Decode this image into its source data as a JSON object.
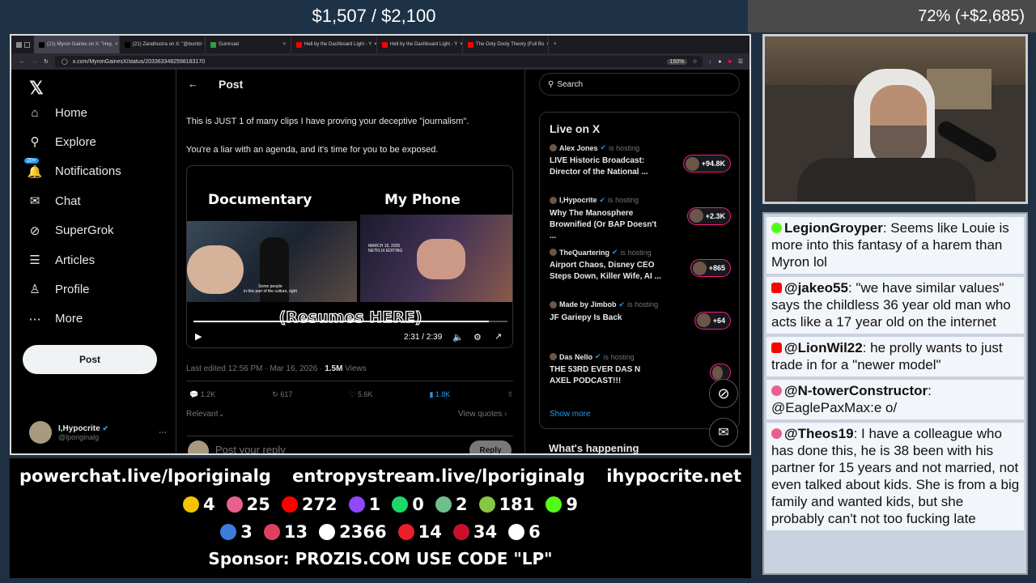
{
  "overlay": {
    "goal": "$1,507 / $2,100",
    "percent": "72% (+$2,685)"
  },
  "browser": {
    "tabs": [
      {
        "label": "(21) Myron Gaines on X: \"Hey,",
        "color": "#000000"
      },
      {
        "label": "(21) Zarathustra on X: \"@bumbl",
        "color": "#000000"
      },
      {
        "label": "Gumroad",
        "color": "#2f9e44"
      },
      {
        "label": "Hell by the Dashboard Light - Y",
        "color": "#ff0000"
      },
      {
        "label": "Hell by the Dashboard Light - Y",
        "color": "#ff0000"
      },
      {
        "label": "The Ooty Dooly Theory (Full Bo",
        "color": "#ff0000"
      }
    ],
    "url": "x.com/MyronGainesX/status/2033633482598183170",
    "zoom": "150%"
  },
  "x": {
    "nav": [
      {
        "label": "Home",
        "icon": "home-icon"
      },
      {
        "label": "Explore",
        "icon": "search-icon"
      },
      {
        "label": "Notifications",
        "icon": "bell-icon",
        "badge": "20+"
      },
      {
        "label": "Chat",
        "icon": "mail-icon"
      },
      {
        "label": "SuperGrok",
        "icon": "grok-icon"
      },
      {
        "label": "Articles",
        "icon": "articles-icon"
      },
      {
        "label": "Profile",
        "icon": "person-icon"
      },
      {
        "label": "More",
        "icon": "more-icon"
      }
    ],
    "post_button": "Post",
    "account": {
      "name": "I,Hypocrite",
      "handle": "@lporiginalg"
    },
    "header_title": "Post",
    "tweet_lines": [
      "This is JUST 1 of many clips I have proving your deceptive \"journalism\".",
      "You're a liar with an agenda, and it's time for you to be exposed."
    ],
    "video": {
      "left_label": "Documentary",
      "right_label": "My Phone",
      "overlay_text": "(Resumes HERE)",
      "caption_left": "Some people\nin this part of the culture, right",
      "caption_right_date": "MARCH 16, 2025\nNETFLIX EDITING",
      "time": "2:31 / 2:39",
      "progress": 0.94
    },
    "meta": {
      "edited": "Last edited 12:56 PM · Mar 16, 2026 ·",
      "views_count": "1.5M",
      "views_label": "Views"
    },
    "actions": {
      "replies": "1.2K",
      "reposts": "617",
      "likes": "5.6K",
      "bookmarks": "1.8K"
    },
    "relevant": "Relevant",
    "view_quotes": "View quotes",
    "reply_placeholder": "Post your reply",
    "reply_button": "Reply",
    "search_placeholder": "Search",
    "live": {
      "title": "Live on X",
      "hosting_label": "is hosting",
      "items": [
        {
          "host": "Alex Jones",
          "title": "LIVE Historic Broadcast: Director of the National ...",
          "count": "+94.8K"
        },
        {
          "host": "I,Hypocrite",
          "title": "Why The Manosphere Brownified (Or BAP Doesn't ...",
          "count": "+2.3K"
        },
        {
          "host": "TheQuartering",
          "title": "Airport Chaos, Disney CEO Steps Down, Killer Wife, AI ...",
          "count": "+865"
        },
        {
          "host": "Made by Jimbob",
          "title": "JF Gariepy Is Back",
          "count": "+64"
        },
        {
          "host": "Das Nello",
          "title": "THE 53RD EVER DAS N AXEL PODCAST!!!",
          "count": ""
        }
      ],
      "show_more": "Show more"
    },
    "whats_happening": "What's happening"
  },
  "chat": [
    {
      "user": "LegionGroyper",
      "text": ": Seems like Louie is more into this fantasy of a harem than Myron lol",
      "platform": "kick",
      "color": "#000000"
    },
    {
      "user": "@jakeo55",
      "text": ": \"we have similar values\" says the childless 36 year old man who acts like a 17 year old on the internet",
      "platform": "youtube",
      "color": "#000000"
    },
    {
      "user": "@LionWil22",
      "text": ": he prolly wants to just trade in for a \"newer model\"",
      "platform": "youtube",
      "color": "#000000"
    },
    {
      "user": "@N-towerConstructor",
      "text": ": @EaglePaxMax:e o/",
      "platform": "rumble",
      "color": "#000000"
    },
    {
      "user": "@Theos19",
      "text": ": I have a colleague who has done this, he is 38 been with his partner for 15 years and not married, not even talked about kids. She is from a big family and wanted kids, but she probably can't not too fucking late",
      "platform": "rumble",
      "color": "#000000"
    }
  ],
  "footer": {
    "links": [
      "powerchat.live/lporiginalg",
      "entropystream.live/lporiginalg",
      "ihypocrite.net"
    ],
    "row1": [
      {
        "icon": "pilled-icon",
        "color": "#f5c400",
        "count": "4"
      },
      {
        "icon": "rumble-pinwheel-icon",
        "color": "#e8618c",
        "count": "25"
      },
      {
        "icon": "youtube-icon",
        "color": "#ff0000",
        "count": "272"
      },
      {
        "icon": "twitch-icon",
        "color": "#9146ff",
        "count": "1"
      },
      {
        "icon": "trovo-icon",
        "color": "#1bd96a",
        "count": "0"
      },
      {
        "icon": "orb-icon",
        "color": "#6fbf8a",
        "count": "2"
      },
      {
        "icon": "rumble-play-icon",
        "color": "#85c742",
        "count": "181"
      },
      {
        "icon": "kick-icon",
        "color": "#53fc18",
        "count": "9"
      }
    ],
    "row2": [
      {
        "icon": "moon-icon",
        "color": "#3b7ddd",
        "count": "3"
      },
      {
        "icon": "pill-icon",
        "color": "#e04060",
        "count": "13"
      },
      {
        "icon": "x-icon",
        "color": "#ffffff",
        "count": "2366"
      },
      {
        "icon": "dlive-icon",
        "color": "#e8202a",
        "count": "14"
      },
      {
        "icon": "cross-icon",
        "color": "#c8102e",
        "count": "34"
      },
      {
        "icon": "grid-icon",
        "color": "#ffffff",
        "count": "6"
      }
    ],
    "sponsor": "Sponsor: PROZIS.COM USE CODE \"LP\""
  }
}
